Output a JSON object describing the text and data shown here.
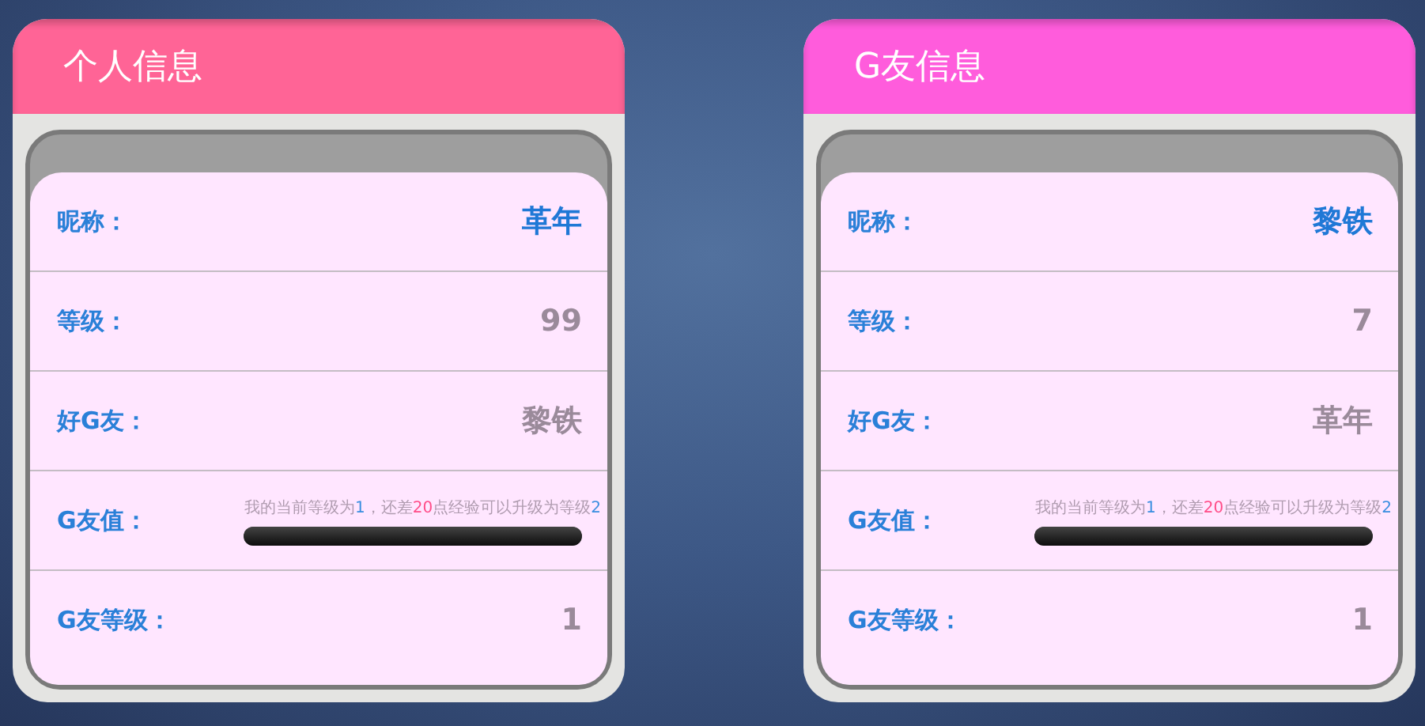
{
  "cards": [
    {
      "title": "个人信息",
      "color": "#ff6496",
      "rows": [
        {
          "kind": "name",
          "label": "昵称：",
          "value": "革年"
        },
        {
          "kind": "plain",
          "label": "等级：",
          "value": "99"
        },
        {
          "kind": "plain",
          "label": "好G友：",
          "value": "黎铁"
        },
        {
          "kind": "progress",
          "label": "G友值：",
          "level": 1,
          "message": [
            {
              "kind": "plain",
              "text": "我的当前等级为"
            },
            {
              "kind": "level",
              "text": "1"
            },
            {
              "kind": "plain",
              "text": "，还差"
            },
            {
              "kind": "points",
              "text": "20"
            },
            {
              "kind": "plain",
              "text": "点经验可以升级为等级"
            },
            {
              "kind": "level",
              "text": "2"
            }
          ]
        },
        {
          "kind": "plain",
          "label": "G友等级：",
          "value": "1"
        }
      ]
    },
    {
      "title": "G友信息",
      "color": "#ff5cdc",
      "rows": [
        {
          "kind": "name",
          "label": "昵称：",
          "value": "黎铁"
        },
        {
          "kind": "plain",
          "label": "等级：",
          "value": "7"
        },
        {
          "kind": "plain",
          "label": "好G友：",
          "value": "革年"
        },
        {
          "kind": "progress",
          "label": "G友值：",
          "level": 1,
          "message": [
            {
              "kind": "plain",
              "text": "我的当前等级为"
            },
            {
              "kind": "level",
              "text": "1"
            },
            {
              "kind": "plain",
              "text": "，还差"
            },
            {
              "kind": "points",
              "text": "20"
            },
            {
              "kind": "plain",
              "text": "点经验可以升级为等级"
            },
            {
              "kind": "level",
              "text": "2"
            }
          ]
        },
        {
          "kind": "plain",
          "label": "G友等级：",
          "value": "1"
        }
      ]
    }
  ]
}
